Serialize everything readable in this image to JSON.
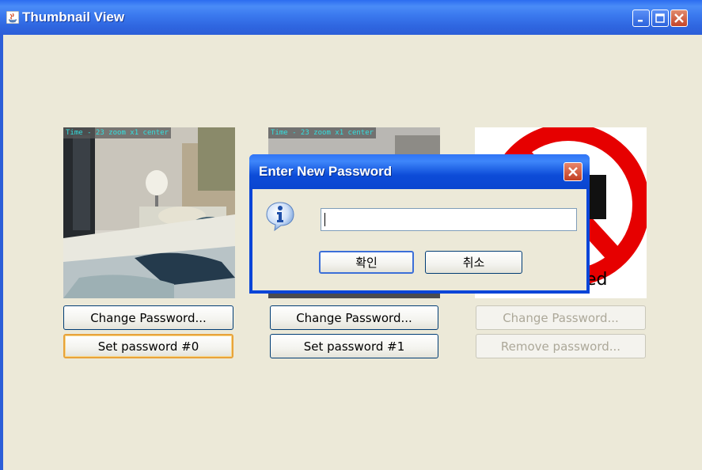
{
  "window": {
    "title": "Thumbnail View",
    "controls": [
      "minimize-icon",
      "maximize-icon",
      "close-icon"
    ],
    "accent_color": "#2C5ED8",
    "background_color": "#ECE9D8"
  },
  "thumbnails": [
    {
      "overlay": "Time - 23 zoom x1 center",
      "change_label": "Change Password...",
      "set_label": "Set password #0"
    },
    {
      "overlay": "Time - 23 zoom x1 center",
      "change_label": "Change Password...",
      "set_label": "Set password #1"
    },
    {
      "overlay_text": "ed",
      "change_label": "Change Password...",
      "remove_label": "Remove password..."
    }
  ],
  "dialog": {
    "title": "Enter New Password",
    "input_value": "",
    "ok_label": "확인",
    "cancel_label": "취소"
  }
}
